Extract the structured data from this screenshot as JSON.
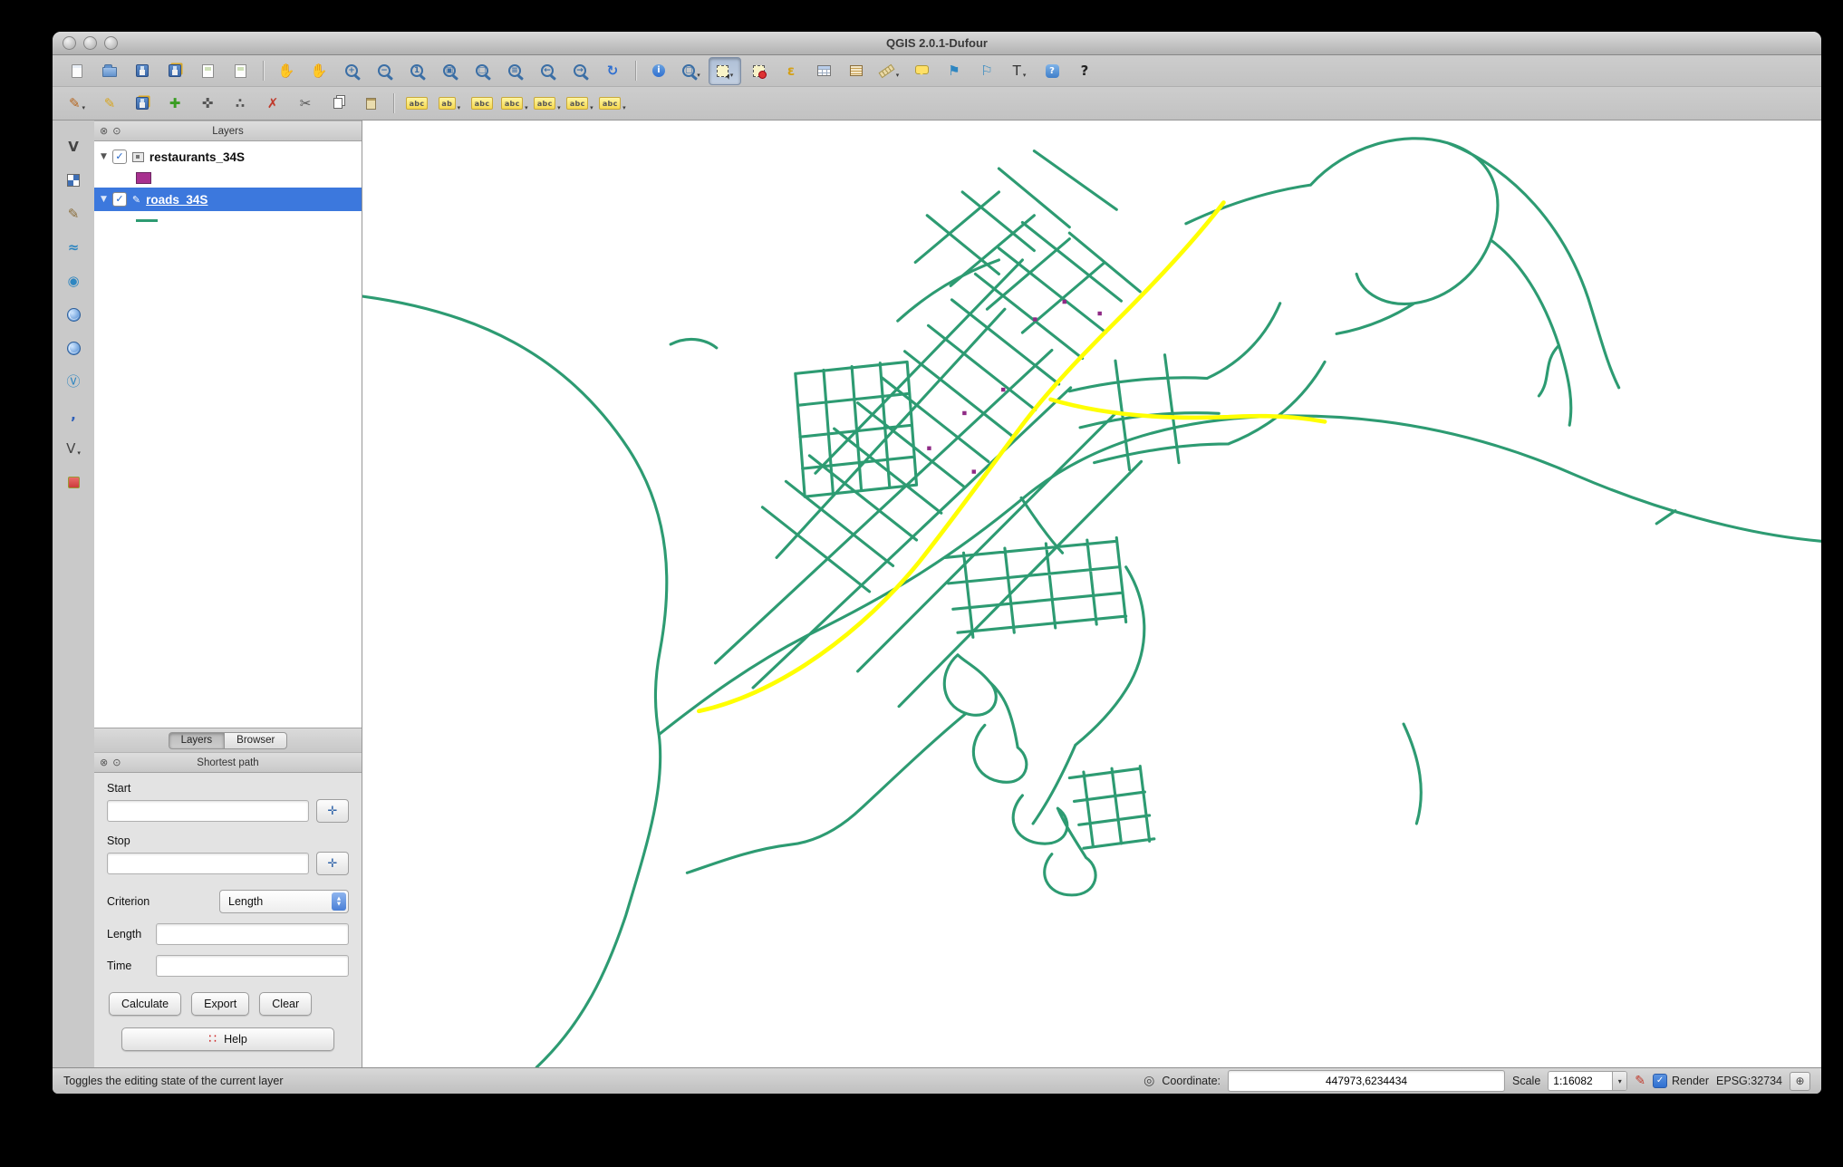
{
  "window": {
    "title": "QGIS 2.0.1-Dufour"
  },
  "colors": {
    "road": "#2d9b72",
    "route": "#ffff00",
    "poi": "#8f2a85",
    "selection": "#3c78dd",
    "restaurants_swatch": "#a8308f"
  },
  "toolbars": {
    "row1": [
      {
        "name": "new-project",
        "kind": "page",
        "icon": "new-document"
      },
      {
        "name": "open-project",
        "kind": "folder",
        "icon": "folder"
      },
      {
        "name": "save-project",
        "kind": "floppy",
        "icon": "floppy-disk"
      },
      {
        "name": "save-project-as",
        "kind": "floppy-pencil",
        "icon": "floppy-disk-pencil"
      },
      {
        "name": "new-print-composer",
        "kind": "composer",
        "icon": "composer-page"
      },
      {
        "name": "composer-manager",
        "kind": "composer-list",
        "icon": "composer-manager"
      },
      {
        "sep": true
      },
      {
        "name": "pan-map",
        "kind": "glyph",
        "glyph": "✋",
        "color": "#b98a4e",
        "icon": "pan-hand"
      },
      {
        "name": "pan-to-selection",
        "kind": "glyph",
        "glyph": "✋",
        "color": "#5f8fc9",
        "icon": "pan-hand-selection"
      },
      {
        "name": "zoom-in",
        "kind": "mag",
        "g": "+",
        "icon": "magnifier-plus"
      },
      {
        "name": "zoom-out",
        "kind": "mag",
        "g": "−",
        "icon": "magnifier-minus"
      },
      {
        "name": "zoom-native",
        "kind": "mag",
        "g": "1",
        "icon": "magnifier-native"
      },
      {
        "name": "zoom-full",
        "kind": "mag",
        "g": "▣",
        "icon": "magnifier-full"
      },
      {
        "name": "zoom-to-selection",
        "kind": "mag",
        "g": "□",
        "icon": "magnifier-selection"
      },
      {
        "name": "zoom-to-layer",
        "kind": "mag",
        "g": "≡",
        "icon": "magnifier-layer"
      },
      {
        "name": "zoom-last",
        "kind": "mag",
        "g": "←",
        "icon": "magnifier-back"
      },
      {
        "name": "zoom-next",
        "kind": "mag",
        "g": "→",
        "icon": "magnifier-forward"
      },
      {
        "name": "refresh-map",
        "kind": "glyph",
        "glyph": "↻",
        "color": "#2f6fd0",
        "bold": true,
        "icon": "refresh-arrows"
      },
      {
        "sep": true
      },
      {
        "name": "identify-features",
        "kind": "info",
        "icon": "identify-info"
      },
      {
        "name": "zoom-to-selected",
        "kind": "mag",
        "g": "▢",
        "dropdown": true,
        "icon": "magnifier-selected"
      },
      {
        "name": "select-features",
        "kind": "select",
        "active": true,
        "dropdown": true,
        "icon": "select-rectangle"
      },
      {
        "name": "deselect-features",
        "kind": "deselect",
        "icon": "deselect-rectangle"
      },
      {
        "name": "select-by-expression",
        "kind": "glyph",
        "glyph": "ε",
        "color": "#d4a017",
        "bold": true,
        "icon": "epsilon"
      },
      {
        "name": "open-attribute-table",
        "kind": "table",
        "icon": "attribute-table"
      },
      {
        "name": "field-calculator",
        "kind": "abacus",
        "icon": "abacus"
      },
      {
        "name": "measure",
        "kind": "ruler",
        "dropdown": true,
        "icon": "ruler"
      },
      {
        "name": "map-tips",
        "kind": "bubble",
        "icon": "speech-bubble"
      },
      {
        "name": "new-bookmark",
        "kind": "glyph",
        "glyph": "⚑",
        "color": "#2e86c1",
        "icon": "bookmark-plus"
      },
      {
        "name": "show-bookmarks",
        "kind": "glyph",
        "glyph": "⚐",
        "color": "#2e86c1",
        "icon": "bookmark"
      },
      {
        "name": "text-annotation",
        "kind": "glyph",
        "glyph": "T",
        "color": "#333333",
        "dropdown": true,
        "icon": "text-annotation"
      },
      {
        "name": "help-contents",
        "kind": "help",
        "icon": "help-question"
      },
      {
        "name": "whats-this",
        "kind": "glyph",
        "glyph": "?",
        "color": "#222222",
        "bold": true,
        "icon": "cursor-question"
      }
    ],
    "row2": [
      {
        "name": "current-edits",
        "kind": "glyph",
        "glyph": "✎",
        "color": "#b5651d",
        "dropdown": true,
        "icon": "pencil"
      },
      {
        "name": "toggle-editing",
        "kind": "glyph",
        "glyph": "✎",
        "color": "#d7a520",
        "icon": "pencil"
      },
      {
        "name": "save-layer-edits",
        "kind": "floppy-pencil",
        "icon": "floppy-disk-pencil"
      },
      {
        "name": "add-feature",
        "kind": "glyph",
        "glyph": "✚",
        "color": "#3a9d23",
        "icon": "add-plus"
      },
      {
        "name": "move-feature",
        "kind": "glyph",
        "glyph": "✜",
        "color": "#555555",
        "icon": "move-cross"
      },
      {
        "name": "node-tool",
        "kind": "glyph",
        "glyph": "∴",
        "color": "#555555",
        "bold": true,
        "icon": "nodes"
      },
      {
        "name": "delete-selected",
        "kind": "glyph",
        "glyph": "✗",
        "color": "#c0392b",
        "icon": "red-x"
      },
      {
        "name": "cut-features",
        "kind": "glyph",
        "glyph": "✂",
        "color": "#555555",
        "icon": "scissors"
      },
      {
        "name": "copy-features",
        "kind": "copy",
        "icon": "copy-pages"
      },
      {
        "name": "paste-features",
        "kind": "paste",
        "icon": "clipboard"
      },
      {
        "sep": true
      },
      {
        "name": "labeling",
        "kind": "chip",
        "text": "abc",
        "icon": "label-abc"
      },
      {
        "name": "label-properties",
        "kind": "chip",
        "text": "ab",
        "dropdown": true,
        "icon": "label-abc"
      },
      {
        "name": "label-pin",
        "kind": "chip",
        "text": "abc",
        "icon": "label-abc"
      },
      {
        "name": "label-show-hide",
        "kind": "chip",
        "text": "abc",
        "dropdown": true,
        "icon": "label-abc"
      },
      {
        "name": "label-move",
        "kind": "chip",
        "text": "abc",
        "dropdown": true,
        "icon": "label-abc"
      },
      {
        "name": "label-rotate",
        "kind": "chip",
        "text": "abc",
        "dropdown": true,
        "icon": "label-abc"
      },
      {
        "name": "label-change",
        "kind": "chip",
        "text": "abc",
        "dropdown": true,
        "icon": "label-abc"
      }
    ],
    "left": [
      {
        "name": "add-vector-layer",
        "kind": "glyph",
        "glyph": "V",
        "color": "#444444",
        "bold": true,
        "icon": "vector-v"
      },
      {
        "name": "add-raster-layer",
        "kind": "checker",
        "icon": "raster-checker"
      },
      {
        "name": "new-shapefile-layer",
        "kind": "glyph",
        "glyph": "✎",
        "color": "#8a6d3b",
        "icon": "pencil"
      },
      {
        "name": "add-spatialite-layer",
        "kind": "glyph",
        "glyph": "≈",
        "color": "#2e86c1",
        "bold": true,
        "icon": "wave"
      },
      {
        "name": "add-mssql-layer",
        "kind": "glyph",
        "glyph": "◉",
        "color": "#2e86c1",
        "icon": "sphere"
      },
      {
        "name": "add-postgis-layer",
        "kind": "globe",
        "icon": "globe"
      },
      {
        "name": "add-wms-layer",
        "kind": "globe",
        "icon": "globe"
      },
      {
        "name": "add-wfs-layer",
        "kind": "glyph",
        "glyph": "Ⓥ",
        "color": "#2e86c1",
        "icon": "globe-v"
      },
      {
        "name": "add-delimited-text-layer",
        "kind": "glyph",
        "glyph": ",",
        "color": "#2e5fb8",
        "bold": true,
        "icon": "comma"
      },
      {
        "name": "add-oracle-layer",
        "kind": "glyph",
        "glyph": "V",
        "color": "#444444",
        "dropdown": true,
        "icon": "vector-v"
      },
      {
        "name": "new-map-view",
        "kind": "redsq",
        "icon": "red-square"
      }
    ]
  },
  "layers_panel": {
    "title": "Layers",
    "items": [
      {
        "label": "restaurants_34S",
        "checked": true,
        "expanded": true,
        "selected": false,
        "editing": false,
        "swatch_type": "fill",
        "swatch_color": "#a8308f"
      },
      {
        "label": "roads_34S",
        "checked": true,
        "expanded": true,
        "selected": true,
        "editing": true,
        "swatch_type": "line",
        "swatch_color": "#2d9b72"
      }
    ],
    "tabs": [
      {
        "label": "Layers",
        "active": true
      },
      {
        "label": "Browser",
        "active": false
      }
    ]
  },
  "shortest_path": {
    "title": "Shortest path",
    "start_label": "Start",
    "start_value": "",
    "stop_label": "Stop",
    "stop_value": "",
    "criterion_label": "Criterion",
    "criterion_value": "Length",
    "length_label": "Length",
    "length_value": "",
    "time_label": "Time",
    "time_value": "",
    "buttons": {
      "calculate": "Calculate",
      "export": "Export",
      "clear": "Clear",
      "help": "Help"
    }
  },
  "statusbar": {
    "hint": "Toggles the editing state of the current layer",
    "coordinate_label": "Coordinate:",
    "coordinate_value": "447973,6234434",
    "scale_label": "Scale",
    "scale_value": "1:16082",
    "render_label": "Render",
    "render_checked": true,
    "crs": "EPSG:32734"
  }
}
